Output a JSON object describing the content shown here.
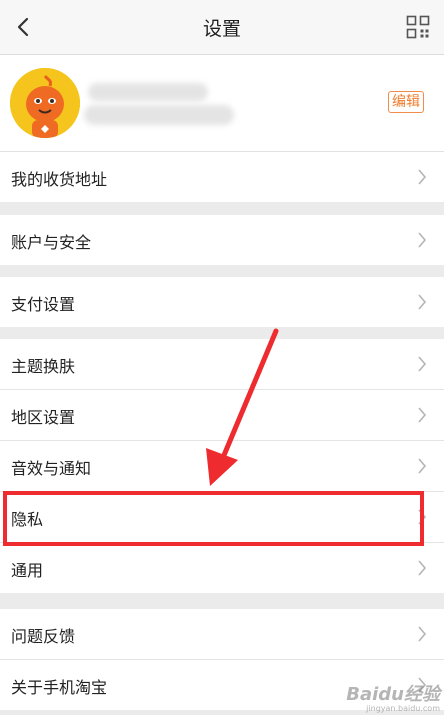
{
  "header": {
    "title": "设置"
  },
  "profile": {
    "edit_label": "编辑"
  },
  "sections": [
    {
      "items": [
        {
          "label": "我的收货地址"
        }
      ]
    },
    {
      "items": [
        {
          "label": "账户与安全"
        }
      ]
    },
    {
      "items": [
        {
          "label": "支付设置"
        }
      ]
    },
    {
      "items": [
        {
          "label": "主题换肤"
        },
        {
          "label": "地区设置"
        },
        {
          "label": "音效与通知"
        },
        {
          "label": "隐私"
        },
        {
          "label": "通用"
        }
      ]
    },
    {
      "items": [
        {
          "label": "问题反馈"
        },
        {
          "label": "关于手机淘宝"
        }
      ]
    }
  ],
  "annotation": {
    "highlighted_item": "隐私",
    "color": "#ee2b2e"
  },
  "watermark": {
    "text": "Baidu经验",
    "sub": "jingyan.baidu.com"
  },
  "icons": {
    "back": "back-arrow-icon",
    "qr": "qr-code-icon",
    "chevron": "chevron-right-icon"
  },
  "colors": {
    "accent": "#f07d2e",
    "avatar": "#f5c51d",
    "annotation": "#ee2b2e"
  }
}
